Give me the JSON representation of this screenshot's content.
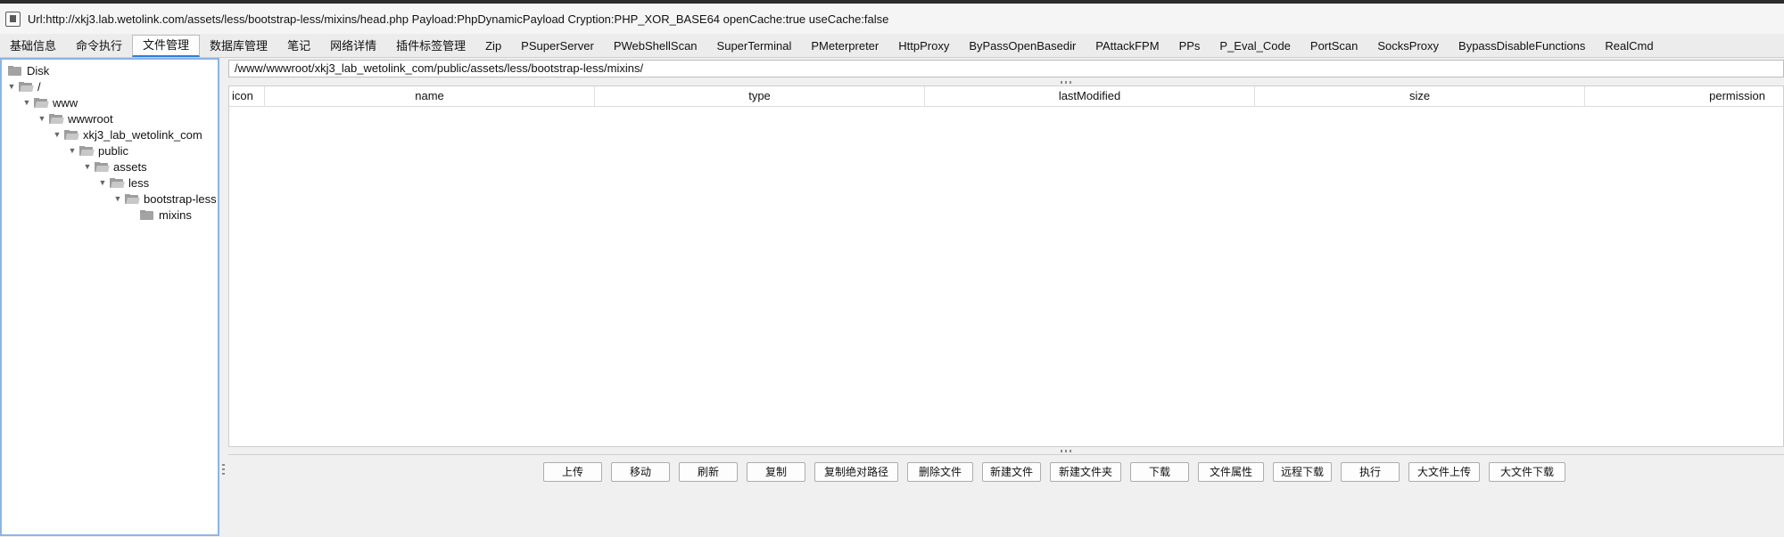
{
  "window": {
    "title": "Url:http://xkj3.lab.wetolink.com/assets/less/bootstrap-less/mixins/head.php Payload:PhpDynamicPayload Cryption:PHP_XOR_BASE64 openCache:true useCache:false"
  },
  "tabs": [
    {
      "label": "基础信息"
    },
    {
      "label": "命令执行"
    },
    {
      "label": "文件管理",
      "active": true
    },
    {
      "label": "数据库管理"
    },
    {
      "label": "笔记"
    },
    {
      "label": "网络详情"
    },
    {
      "label": "插件标签管理"
    },
    {
      "label": "Zip"
    },
    {
      "label": "PSuperServer"
    },
    {
      "label": "PWebShellScan"
    },
    {
      "label": "SuperTerminal"
    },
    {
      "label": "PMeterpreter"
    },
    {
      "label": "HttpProxy"
    },
    {
      "label": "ByPassOpenBasedir"
    },
    {
      "label": "PAttackFPM"
    },
    {
      "label": "PPs"
    },
    {
      "label": "P_Eval_Code"
    },
    {
      "label": "PortScan"
    },
    {
      "label": "SocksProxy"
    },
    {
      "label": "BypassDisableFunctions"
    },
    {
      "label": "RealCmd"
    }
  ],
  "tree": [
    {
      "label": "Disk",
      "depth": 0,
      "arrow": false,
      "icon": "folder-icon"
    },
    {
      "label": "/",
      "depth": 0,
      "arrow": true,
      "icon": "open-folder-icon"
    },
    {
      "label": "www",
      "depth": 1,
      "arrow": true,
      "icon": "open-folder-icon"
    },
    {
      "label": "wwwroot",
      "depth": 2,
      "arrow": true,
      "icon": "open-folder-icon"
    },
    {
      "label": "xkj3_lab_wetolink_com",
      "depth": 3,
      "arrow": true,
      "icon": "open-folder-icon"
    },
    {
      "label": "public",
      "depth": 4,
      "arrow": true,
      "icon": "open-folder-icon"
    },
    {
      "label": "assets",
      "depth": 5,
      "arrow": true,
      "icon": "open-folder-icon"
    },
    {
      "label": "less",
      "depth": 6,
      "arrow": true,
      "icon": "open-folder-icon"
    },
    {
      "label": "bootstrap-less",
      "depth": 7,
      "arrow": true,
      "icon": "open-folder-icon"
    },
    {
      "label": "mixins",
      "depth": 8,
      "arrow": false,
      "icon": "folder-icon"
    }
  ],
  "path": "/www/wwwroot/xkj3_lab_wetolink_com/public/assets/less/bootstrap-less/mixins/",
  "columns": [
    "icon",
    "name",
    "type",
    "lastModified",
    "size",
    "permission"
  ],
  "rows": [],
  "actions": [
    "上传",
    "移动",
    "刷新",
    "复制",
    "复制绝对路径",
    "删除文件",
    "新建文件",
    "新建文件夹",
    "下载",
    "文件属性",
    "远程下载",
    "执行",
    "大文件上传",
    "大文件下载"
  ],
  "colors": {
    "accent": "#2f7de1",
    "tree_border": "#8fb4e3"
  }
}
